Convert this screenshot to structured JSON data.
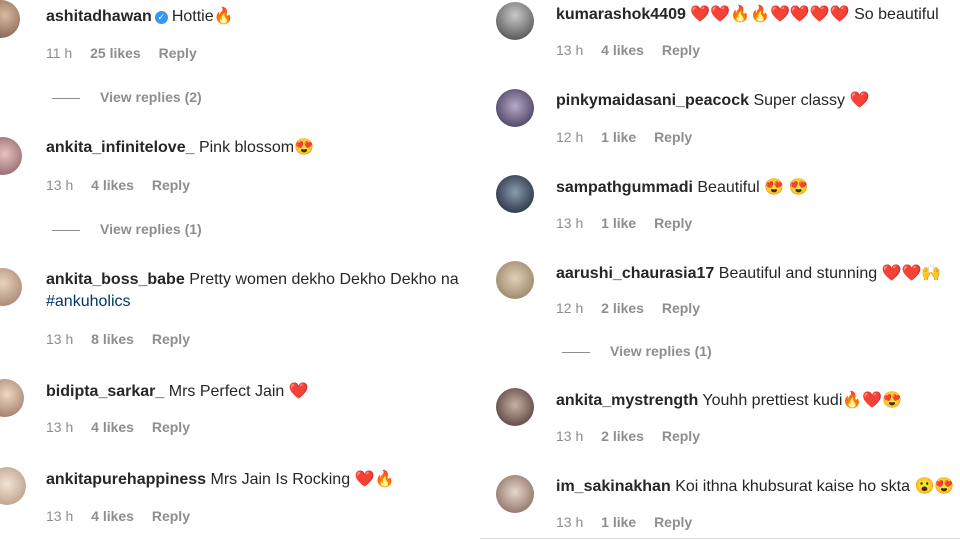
{
  "colors": {
    "text": "#262626",
    "meta": "#8e8e8e",
    "hashtag": "#00376b",
    "verified": "#3897f0",
    "heart": "#ed4956"
  },
  "left": [
    {
      "username": "ashitadhawan",
      "verified": true,
      "text": "Hottie🔥",
      "time": "11 h",
      "likes": "25 likes",
      "reply": "Reply",
      "view_replies": "View replies (2)"
    },
    {
      "username": "ankita_infinitelove_",
      "text": "Pink blossom😍",
      "time": "13 h",
      "likes": "4 likes",
      "reply": "Reply",
      "view_replies": "View replies (1)"
    },
    {
      "username": "ankita_boss_babe",
      "text": "Pretty women dekho Dekho Dekho na",
      "hashtag": "#ankuholics",
      "time": "13 h",
      "likes": "8 likes",
      "reply": "Reply"
    },
    {
      "username": "bidipta_sarkar_",
      "text": "Mrs Perfect Jain ❤️",
      "time": "13 h",
      "likes": "4 likes",
      "reply": "Reply"
    },
    {
      "username": "ankitapurehappiness",
      "text": "Mrs Jain Is Rocking ❤️🔥",
      "time": "13 h",
      "likes": "4 likes",
      "reply": "Reply"
    }
  ],
  "right": [
    {
      "username": "kumarashok4409",
      "text": "❤️❤️🔥🔥❤️❤️❤️❤️ So beautiful",
      "time": "13 h",
      "likes": "4 likes",
      "reply": "Reply"
    },
    {
      "username": "pinkymaidasani_peacock",
      "text": "Super classy ❤️",
      "time": "12 h",
      "likes": "1 like",
      "reply": "Reply"
    },
    {
      "username": "sampathgummadi",
      "text": "Beautiful 😍 😍",
      "time": "13 h",
      "likes": "1 like",
      "reply": "Reply"
    },
    {
      "username": "aarushi_chaurasia17",
      "text": "Beautiful and stunning ❤️❤️🙌",
      "time": "12 h",
      "likes": "2 likes",
      "reply": "Reply",
      "view_replies": "View replies (1)"
    },
    {
      "username": "ankita_mystrength",
      "text": "Youhh prettiest kudi🔥❤️😍",
      "time": "13 h",
      "likes": "2 likes",
      "reply": "Reply"
    },
    {
      "username": "im_sakinakhan",
      "text": "Koi ithna khubsurat kaise ho skta 😮😍",
      "time": "13 h",
      "likes": "1 like",
      "reply": "Reply"
    }
  ]
}
